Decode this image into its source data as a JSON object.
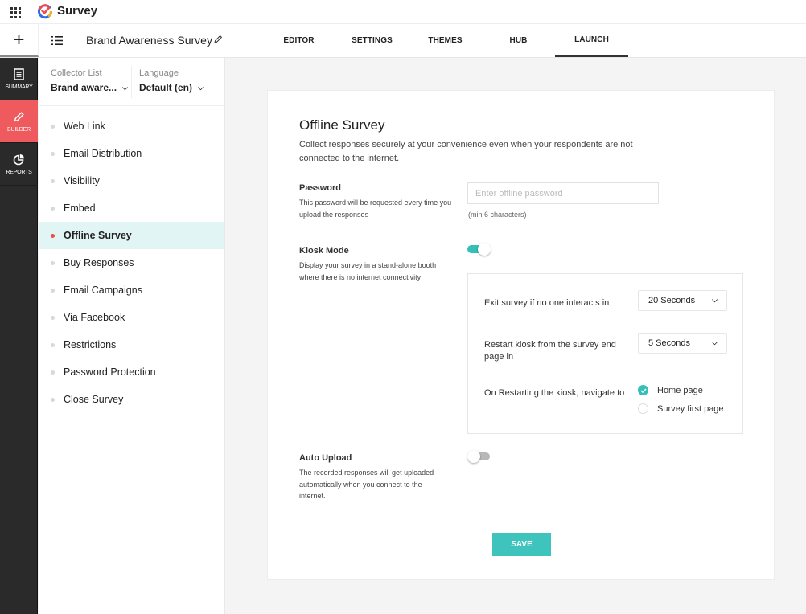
{
  "app": {
    "title": "Survey"
  },
  "header": {
    "add_label": "+",
    "survey_name": "Brand Awareness Survey",
    "tabs": [
      {
        "label": "EDITOR",
        "active": false
      },
      {
        "label": "SETTINGS",
        "active": false
      },
      {
        "label": "THEMES",
        "active": false
      },
      {
        "label": "HUB",
        "active": false
      },
      {
        "label": "LAUNCH",
        "active": true
      }
    ]
  },
  "rail": {
    "items": [
      {
        "label": "SUMMARY",
        "icon": "document-icon",
        "active": false
      },
      {
        "label": "BUILDER",
        "icon": "pencil-icon",
        "active": true
      },
      {
        "label": "REPORTS",
        "icon": "pie-chart-icon",
        "active": false
      }
    ]
  },
  "sidebar": {
    "collector": {
      "caption": "Collector List",
      "value": "Brand aware..."
    },
    "language": {
      "caption": "Language",
      "value": "Default (en)"
    },
    "items": [
      {
        "label": "Web Link",
        "active": false
      },
      {
        "label": "Email Distribution",
        "active": false
      },
      {
        "label": "Visibility",
        "active": false
      },
      {
        "label": "Embed",
        "active": false
      },
      {
        "label": "Offline Survey",
        "active": true
      },
      {
        "label": "Buy Responses",
        "active": false
      },
      {
        "label": "Email Campaigns",
        "active": false
      },
      {
        "label": "Via Facebook",
        "active": false
      },
      {
        "label": "Restrictions",
        "active": false
      },
      {
        "label": "Password Protection",
        "active": false
      },
      {
        "label": "Close Survey",
        "active": false
      }
    ]
  },
  "main": {
    "title": "Offline Survey",
    "intro": "Collect responses securely at your convenience even when your respondents are not connected to the internet.",
    "password": {
      "title": "Password",
      "description": "This password will be requested every time you upload the responses",
      "value": "",
      "placeholder": "Enter offline password",
      "hint": "(min 6 characters)"
    },
    "kiosk": {
      "title": "Kiosk Mode",
      "description": "Display your survey in a stand-alone booth where there is no internet connectivity",
      "enabled": true,
      "exit_label": "Exit survey if no one interacts in",
      "exit_value": "20 Seconds",
      "restart_label": "Restart kiosk from the survey end page in",
      "restart_value": "5 Seconds",
      "navigate_label": "On Restarting the kiosk, navigate to",
      "navigate_options": [
        {
          "label": "Home page",
          "checked": true
        },
        {
          "label": "Survey first page",
          "checked": false
        }
      ]
    },
    "auto_upload": {
      "title": "Auto Upload",
      "description": "The recorded responses will get uploaded automatically when you connect to the internet.",
      "enabled": false
    },
    "save_label": "SAVE"
  },
  "colors": {
    "accent": "#3ec4bd",
    "builder_active": "#ef5a5e",
    "active_dot": "#ef4b4b",
    "active_row": "#e1f5f4",
    "rail_bg": "#2a2a2a"
  }
}
